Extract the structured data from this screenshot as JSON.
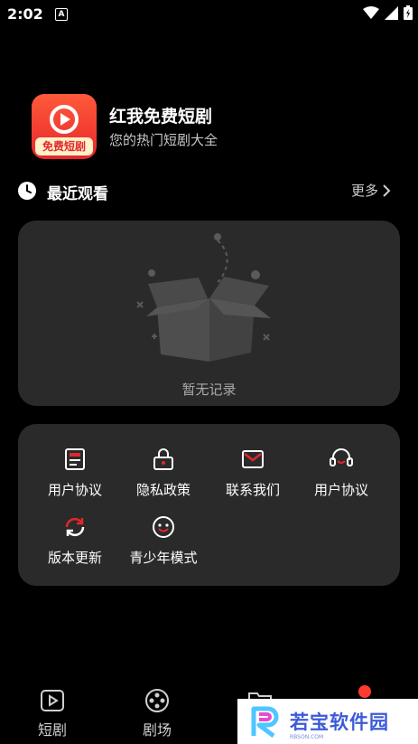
{
  "status_bar": {
    "time": "2:02",
    "indicator": "A"
  },
  "app": {
    "title": "红我免费短剧",
    "subtitle": "您的热门短剧大全",
    "icon_badge": "免费短剧"
  },
  "recent": {
    "title": "最近观看",
    "more_label": "更多",
    "empty_text": "暂无记录"
  },
  "menu": {
    "items": [
      {
        "label": "用户协议",
        "icon": "document-icon"
      },
      {
        "label": "隐私政策",
        "icon": "lock-icon"
      },
      {
        "label": "联系我们",
        "icon": "mail-icon"
      },
      {
        "label": "用户协议",
        "icon": "headset-icon"
      },
      {
        "label": "版本更新",
        "icon": "refresh-icon"
      },
      {
        "label": "青少年模式",
        "icon": "smiley-icon"
      }
    ]
  },
  "tabs": [
    {
      "label": "短剧",
      "icon": "play-icon"
    },
    {
      "label": "剧场",
      "icon": "film-reel-icon"
    },
    {
      "label": "",
      "icon": "folder-icon"
    }
  ],
  "watermark": {
    "text": "若宝软件园",
    "sub": "RBSON.COM"
  },
  "colors": {
    "accent": "#e2262d",
    "card": "#2a2a2a",
    "background": "#000000",
    "watermark": "#3d5bd8"
  }
}
